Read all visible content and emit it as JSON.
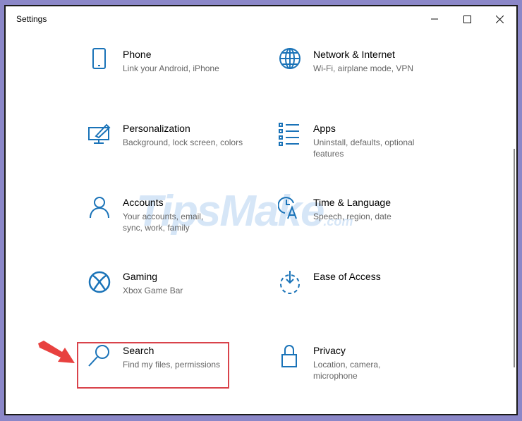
{
  "window": {
    "title": "Settings",
    "controls": {
      "minimize": "minimize-icon",
      "maximize": "maximize-icon",
      "close": "close-icon"
    }
  },
  "items": [
    {
      "title": "Phone",
      "subtitle": "Link your Android, iPhone",
      "icon": "phone-icon"
    },
    {
      "title": "Network & Internet",
      "subtitle": "Wi-Fi, airplane mode, VPN",
      "icon": "globe-icon"
    },
    {
      "title": "Personalization",
      "subtitle": "Background, lock screen, colors",
      "icon": "personalization-icon"
    },
    {
      "title": "Apps",
      "subtitle": "Uninstall, defaults, optional features",
      "icon": "apps-list-icon"
    },
    {
      "title": "Accounts",
      "subtitle": "Your accounts, email, sync, work, family",
      "icon": "person-icon"
    },
    {
      "title": "Time & Language",
      "subtitle": "Speech, region, date",
      "icon": "time-language-icon"
    },
    {
      "title": "Gaming",
      "subtitle": "Xbox Game Bar",
      "icon": "xbox-icon"
    },
    {
      "title": "Ease of Access",
      "subtitle": "",
      "icon": "ease-of-access-icon"
    },
    {
      "title": "Search",
      "subtitle": "Find my files, permissions",
      "icon": "search-icon"
    },
    {
      "title": "Privacy",
      "subtitle": "Location, camera, microphone",
      "icon": "lock-icon"
    }
  ],
  "colors": {
    "accent": "#1a73b8",
    "highlight": "#d9434b",
    "frame": "#8b87c8"
  },
  "watermark": {
    "text": "TipsMake",
    ".com": ".com"
  }
}
